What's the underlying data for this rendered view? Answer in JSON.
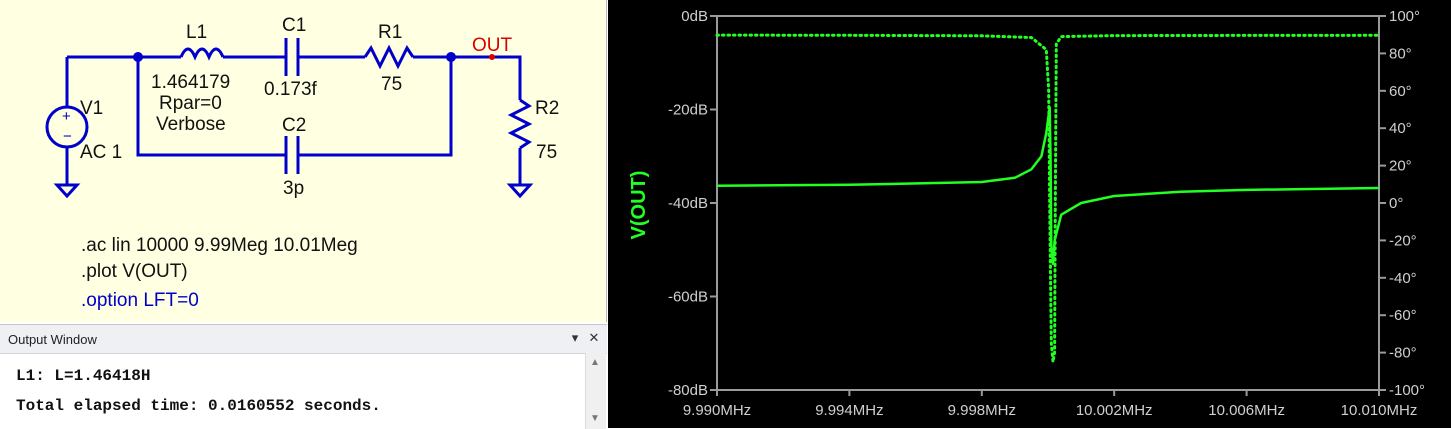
{
  "schematic": {
    "components": {
      "v1": {
        "ref": "V1",
        "value": "AC 1"
      },
      "l1": {
        "ref": "L1",
        "value": "1.464179",
        "param1": "Rpar=0",
        "param2": "Verbose"
      },
      "c1": {
        "ref": "C1",
        "value": "0.173f"
      },
      "r1": {
        "ref": "R1",
        "value": "75"
      },
      "c2": {
        "ref": "C2",
        "value": "3p"
      },
      "r2": {
        "ref": "R2",
        "value": "75"
      }
    },
    "net_label": "OUT",
    "directives": [
      ".ac lin 10000 9.99Meg 10.01Meg",
      ".plot V(OUT)",
      ".option LFT=0"
    ]
  },
  "output_window": {
    "title": "Output Window",
    "pin_icon": "dropdown-arrow-icon",
    "close_icon": "close-icon",
    "lines": [
      "L1: L=1.46418H",
      "Total elapsed time: 0.0160552 seconds."
    ]
  },
  "colors": {
    "wire": "#0000cc",
    "net_label": "#dd0000",
    "trace": "#22ff22",
    "plot_bg": "#000000",
    "schematic_bg": "#ffffe1",
    "directive_option": "#0000cc"
  },
  "chart_data": {
    "type": "line",
    "trace_label": "V(OUT)",
    "x_unit": "MHz",
    "x_range": [
      9.99,
      10.01
    ],
    "x_ticks": [
      "9.990MHz",
      "9.994MHz",
      "9.998MHz",
      "10.002MHz",
      "10.006MHz",
      "10.010MHz"
    ],
    "y_left_range": [
      -80,
      0
    ],
    "y_left_ticks": [
      "0dB",
      "-20dB",
      "-40dB",
      "-60dB",
      "-80dB"
    ],
    "y_right_range": [
      -100,
      100
    ],
    "y_right_ticks": [
      "100°",
      "80°",
      "60°",
      "40°",
      "20°",
      "0°",
      "-20°",
      "-40°",
      "-60°",
      "-80°",
      "-100°"
    ],
    "series": [
      {
        "style": "solid",
        "x": [
          9.99,
          9.994,
          9.998,
          9.999,
          9.9995,
          9.9998,
          9.99995,
          10.00005,
          10.00008,
          10.0001,
          10.00015,
          10.0002,
          10.0004,
          10.001,
          10.002,
          10.004,
          10.006,
          10.01
        ],
        "y": [
          -36.3,
          -36.1,
          -35.5,
          -34.6,
          -32.8,
          -30.0,
          -25.0,
          -19.5,
          -31.0,
          -49.0,
          -53.0,
          -48.0,
          -42.5,
          -40.0,
          -38.5,
          -37.6,
          -37.2,
          -36.8
        ]
      },
      {
        "style": "dotted",
        "x": [
          9.99,
          9.994,
          9.998,
          9.9995,
          9.99995,
          10.00002,
          10.00005,
          10.0001,
          10.00015,
          10.0002,
          10.00022,
          10.00025,
          10.0004,
          10.002,
          10.006,
          10.01
        ],
        "y": [
          89.8,
          89.7,
          89.4,
          88.5,
          82.0,
          60.0,
          0.0,
          -75.0,
          -85.0,
          -80.0,
          0.0,
          85.0,
          89.0,
          89.5,
          89.6,
          89.7
        ]
      }
    ]
  }
}
